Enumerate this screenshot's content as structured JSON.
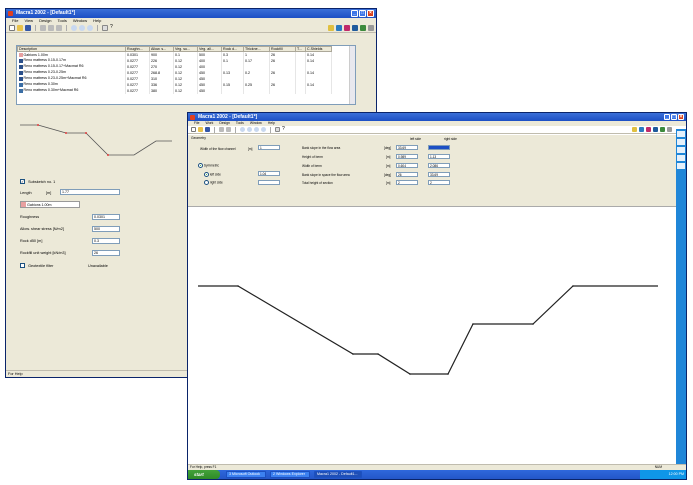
{
  "back_window": {
    "title": "Macra1 2002 - [Default1*]",
    "menu": [
      "File",
      "View",
      "Design",
      "Tools",
      "Window",
      "Help"
    ],
    "table": {
      "columns": [
        "Description",
        "Roughn...",
        "Allow. s...",
        "Veg. su...",
        "Veg. all...",
        "Rock d...",
        "Thickne...",
        "Rockfill",
        "T...",
        "C.Shields"
      ],
      "rows": [
        {
          "color": "#e8a0a0",
          "cells": [
            "Gabions 1.00m",
            "0.0301",
            "900",
            "0.1",
            "500",
            "0.3",
            "1",
            "26",
            "",
            "0.14"
          ]
        },
        {
          "color": "#2a4f8a",
          "cells": [
            "Reno mattress 0.15-0.17m",
            "0.0277",
            "226",
            "0.12",
            "400",
            "0.1",
            "0.17",
            "26",
            "",
            "0.14"
          ]
        },
        {
          "color": "#2a4f8a",
          "cells": [
            "Reno mattress 0.15-0.17+Macmat R6",
            "0.0277",
            "270",
            "0.12",
            "400",
            "",
            "",
            "",
            "",
            ""
          ]
        },
        {
          "color": "#2a4f8a",
          "cells": [
            "Reno mattress 0.23-0.25m",
            "0.0277",
            "268.8",
            "0.12",
            "450",
            "0.13",
            "0.2",
            "26",
            "",
            "0.14"
          ]
        },
        {
          "color": "#2a4f8a",
          "cells": [
            "Reno mattress 0.23-0.25m+Macmat R6",
            "0.0277",
            "310",
            "0.12",
            "450",
            "",
            "",
            "",
            "",
            ""
          ]
        },
        {
          "color": "#3b6ea5",
          "cells": [
            "Reno mattress 0.30m",
            "0.0277",
            "336",
            "0.12",
            "450",
            "0.15",
            "0.25",
            "26",
            "",
            "0.14"
          ]
        },
        {
          "color": "#3b6ea5",
          "cells": [
            "Reno mattress 0.30m+Macmat R6",
            "0.0277",
            "380",
            "0.12",
            "450",
            "",
            "",
            "",
            "",
            ""
          ]
        }
      ]
    },
    "subsketch": {
      "checkbox_label": "Subsketch no. 1",
      "length_label": "Length",
      "length_unit": "[m]",
      "length_value": "1.77",
      "material": "Gabions 1.00m",
      "properties": [
        {
          "label": "Roughness",
          "value": "0.0301"
        },
        {
          "label": "Allow. shear stress [N/m2]",
          "value": "500"
        },
        {
          "label": "Rock d50 [m]",
          "value": "0.3"
        },
        {
          "label": "Rockfill unit weight [kN/m3]",
          "value": "26"
        }
      ],
      "geomat_label": "Geotextile filter",
      "unavailable_label": "Unavailable"
    },
    "status": "For Help"
  },
  "front_window": {
    "title": "Macra1 2002 - [Default1*]",
    "menu": [
      "File",
      "Work",
      "Design",
      "Tools",
      "Window",
      "Help"
    ],
    "geometry_title": "Geometry",
    "left_side_label": "left side",
    "right_side_label": "right side",
    "width_label": "Width of the flow channel",
    "width_unit": "[m]",
    "width_value": "1",
    "bank_slope_label": "Bank slope in the flow area",
    "bank_slope_unit": "[deg]",
    "bank_slope_left": "33.69",
    "bank_slope_right": "",
    "height_label": "Height of berm",
    "height_unit": "[m]",
    "height_left": "0.989",
    "height_right": "1.13",
    "berm_width_label": "Width of berm",
    "berm_width_unit": "[m]",
    "berm_width_left": "0.604",
    "berm_width_right": "2.086",
    "slope_above_label": "Bank slope in space the flow area",
    "slope_above_unit": "[deg]",
    "slope_above_left": "26",
    "slope_above_right": "33.69",
    "total_height_label": "Total height of section",
    "total_height_unit": "[m]",
    "total_height_left": "2",
    "total_height_right": "2",
    "symmetric_label": "Symmetric",
    "radio_left": "left side",
    "radio_right": "right side",
    "radio_value": "1.04",
    "status": "For Help, press F1",
    "status_right": "NUM"
  },
  "taskbar": {
    "start": "start",
    "items": [
      "3 Microsoft Outlook",
      "2 Windows Explorer",
      "Macra1 2002 - Default1..."
    ],
    "clock": "12:00 PM"
  },
  "colors": {
    "titlebar": "#1c4fc4",
    "section_line": "#222222",
    "back_section_nodes": "#e04040"
  },
  "icons": [
    "new-icon",
    "open-icon",
    "save-icon",
    "zoom-in-icon",
    "zoom-out-icon",
    "help-icon",
    "close-icon",
    "minimize-icon",
    "maximize-icon"
  ]
}
